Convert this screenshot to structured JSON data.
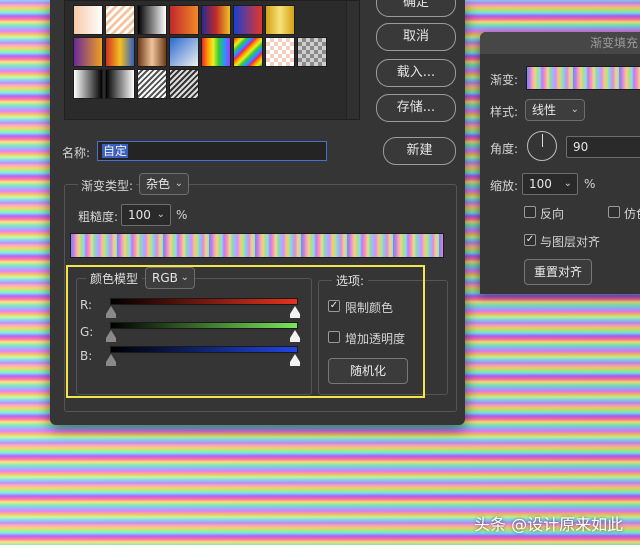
{
  "main_dialog": {
    "buttons": {
      "ok": "确定",
      "cancel": "取消",
      "load": "载入...",
      "save": "存储...",
      "new": "新建"
    },
    "name_label": "名称:",
    "name_value": "自定",
    "gradient_type_label": "渐变类型:",
    "gradient_type_value": "杂色",
    "roughness_label": "粗糙度:",
    "roughness_value": "100",
    "roughness_unit": "%",
    "color_model": {
      "legend": "颜色模型",
      "value": "RGB",
      "channels": [
        {
          "label": "R:",
          "color": "#e8321e"
        },
        {
          "label": "G:",
          "color": "#78e65a"
        },
        {
          "label": "B:",
          "color": "#2146e6"
        }
      ]
    },
    "options": {
      "legend": "选项:",
      "restrict_colors": {
        "label": "限制颜色",
        "checked": true
      },
      "add_transparency": {
        "label": "增加透明度",
        "checked": false
      },
      "randomize": "随机化"
    }
  },
  "gradient_fill_panel": {
    "title": "渐变填充",
    "gradient_label": "渐变:",
    "style_label": "样式:",
    "style_value": "线性",
    "angle_label": "角度:",
    "angle_value": "90",
    "scale_label": "缩放:",
    "scale_value": "100",
    "scale_unit": "%",
    "reverse": {
      "label": "反向",
      "checked": false
    },
    "dither": {
      "label": "仿色",
      "checked": false
    },
    "align_with_layer": {
      "label": "与图层对齐",
      "checked": true
    },
    "reset_align": "重置对齐"
  },
  "watermark": "头条 @设计原来如此",
  "colors": {
    "highlight": "#f4e64a",
    "field_border": "#4a6fd0"
  }
}
